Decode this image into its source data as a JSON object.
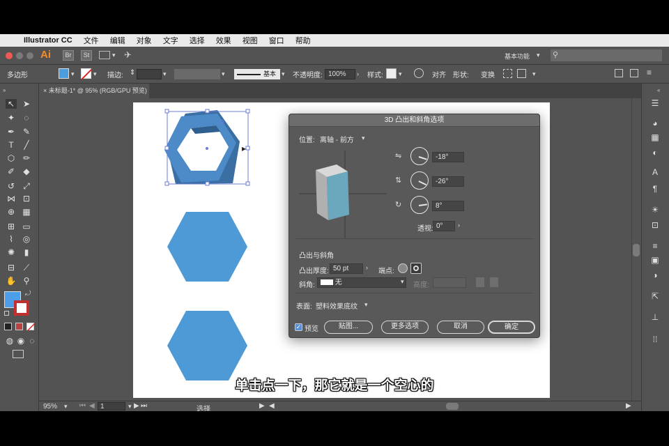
{
  "menubar": {
    "app_name": "Illustrator CC",
    "items": [
      "文件",
      "编辑",
      "对象",
      "文字",
      "选择",
      "效果",
      "视图",
      "窗口",
      "帮助"
    ]
  },
  "appbar": {
    "logo": "Ai",
    "br_label": "Br",
    "st_label": "St",
    "workspace": "基本功能"
  },
  "control": {
    "tool_name": "多边形",
    "stroke_label": "描边:",
    "stroke_style": "基本",
    "opacity_label": "不透明度:",
    "opacity_value": "100%",
    "style_label": "样式:",
    "align_label": "对齐",
    "shape_label": "形状:",
    "transform_label": "变换",
    "fill_color": "#4a9ee0"
  },
  "document": {
    "tab_label": "未标题-1* @ 95% (RGB/GPU 预览)"
  },
  "status": {
    "zoom": "95%",
    "page": "1",
    "tool": "选择"
  },
  "dialog": {
    "title": "3D 凸出和斜角选项",
    "position_label": "位置:",
    "position_value": "离轴 - 前方",
    "rot_x": "-18°",
    "rot_y": "-26°",
    "rot_z": "8°",
    "perspective_label": "透视:",
    "perspective_value": "0°",
    "section_extrude": "凸出与斜角",
    "depth_label": "凸出厚度:",
    "depth_value": "50 pt",
    "cap_label": "端点:",
    "bevel_label": "斜角:",
    "bevel_value": "无",
    "height_label": "高度:",
    "surface_label": "表面:",
    "surface_value": "塑料效果底纹",
    "preview_label": "预览",
    "map_button": "贴图...",
    "more_button": "更多选项",
    "cancel_button": "取消",
    "ok_button": "确定"
  },
  "subtitle": "单击点一下，那它就是一个空心的",
  "colors": {
    "hexagon": "#4d9ad6",
    "hexagon_3d": "#3b6fa3",
    "cube_front": "#6ba8bd",
    "cube_side": "#b0b0b0"
  }
}
